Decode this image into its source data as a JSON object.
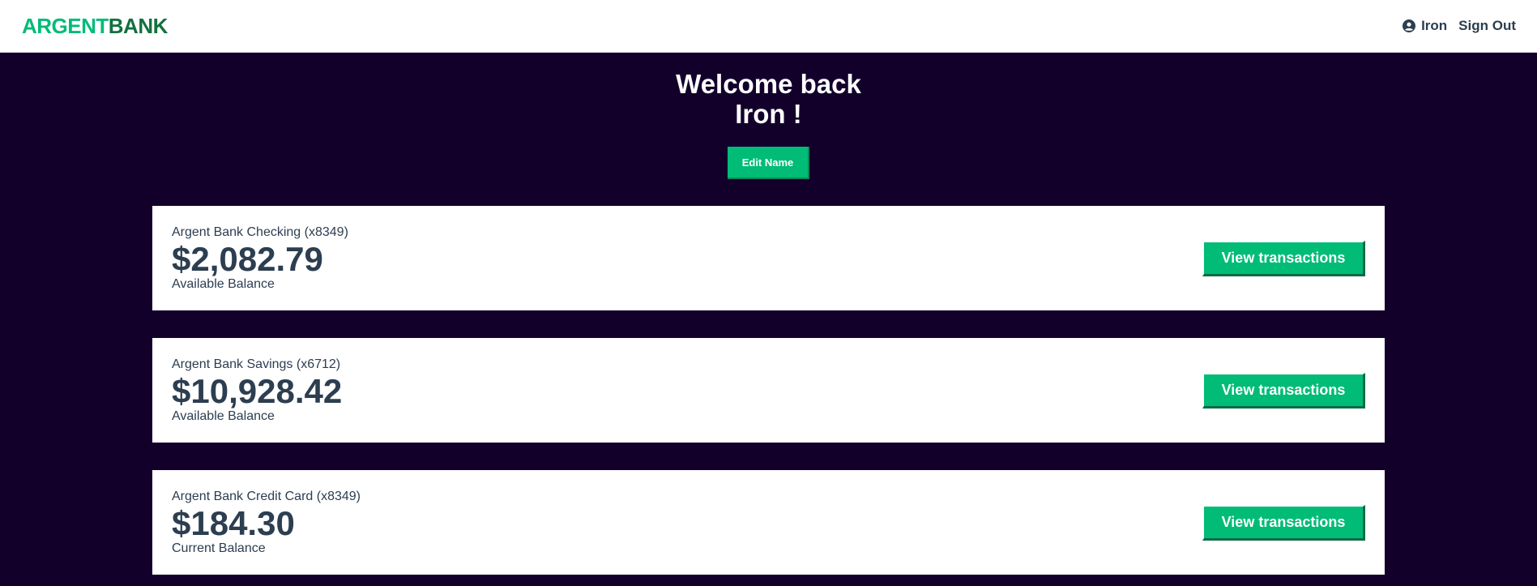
{
  "navbar": {
    "logo_part1": "ARGENT",
    "logo_part2": "BANK",
    "user_name": "Iron",
    "sign_out_label": "Sign Out",
    "user_icon": "user-circle-icon"
  },
  "header": {
    "welcome_line1": "Welcome back",
    "welcome_line2": "Iron !",
    "edit_name_label": "Edit Name"
  },
  "accounts": [
    {
      "title": "Argent Bank Checking (x8349)",
      "amount": "$2,082.79",
      "description": "Available Balance",
      "button_label": "View transactions"
    },
    {
      "title": "Argent Bank Savings (x6712)",
      "amount": "$10,928.42",
      "description": "Available Balance",
      "button_label": "View transactions"
    },
    {
      "title": "Argent Bank Credit Card (x8349)",
      "amount": "$184.30",
      "description": "Current Balance",
      "button_label": "View transactions"
    }
  ],
  "colors": {
    "accent": "#00bc77",
    "background": "#12002b",
    "text": "#2c3e50"
  }
}
